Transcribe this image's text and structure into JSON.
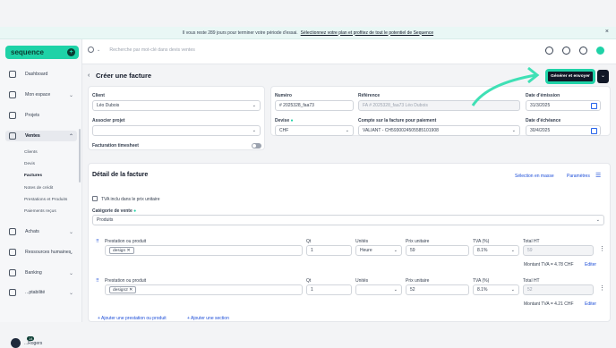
{
  "banner": {
    "text": "Il vous reste 289 jours pour terminer votre période d'essai.",
    "link": "Sélectionnez votre plan et profitez de tout le potentiel de Sequence"
  },
  "logo": {
    "text": "sequence"
  },
  "sidebar": {
    "items": [
      "Dashboard",
      "Mon espace",
      "Projets",
      "Ventes",
      "Achats",
      "Ressources humaines",
      "Banking",
      "...ptabilité"
    ],
    "ventes_sub": [
      "Clients",
      "Devis",
      "Factures",
      "Notes de crédit",
      "Prestations et Produits",
      "Paiements reçus"
    ],
    "user": "...Rogers",
    "badge": "14"
  },
  "topbar": {
    "search_placeholder": "Recherche par mot-clé dans devis ventes"
  },
  "page": {
    "title": "Créer une facture",
    "generate_button": "Générer et envoyer"
  },
  "form": {
    "client_label": "Client",
    "client_value": "Léo Dubois",
    "project_label": "Associer projet",
    "timesheet_label": "Facturation timesheet",
    "number_label": "Numéro",
    "number_value": "# 2025328_faa73",
    "reference_label": "Référence",
    "reference_value": "FA # 2025328_faa73 Léo Dubois",
    "emission_label": "Date d'émission",
    "emission_value": "31/3/2025",
    "currency_label": "Devise",
    "currency_value": "CHF",
    "account_label": "Compte sur la facture pour paiement",
    "account_value": "VALIANT - CH5930024505585101908",
    "due_label": "Date d'échéance",
    "due_value": "30/4/2025"
  },
  "details": {
    "title": "Détail de la facture",
    "bulk_link": "Sélection en masse",
    "params_link": "Paramètres",
    "tva_checkbox": "TVA inclu dans le prix unitaire",
    "category_label": "Catégorie de vente",
    "category_value": "Produits",
    "col_prestation": "Prestation ou produit",
    "col_qt": "Qt",
    "col_units": "Unités",
    "col_price": "Prix unitaire",
    "col_tva": "TVA (%)",
    "col_total": "Total HT",
    "rows": [
      {
        "tag": "design",
        "qt": "1",
        "unit": "Heure",
        "price": "59",
        "tva": "8.1%",
        "total": "59",
        "tva_amount": "Montant TVA = 4.78 CHF",
        "edit": "Editer"
      },
      {
        "tag": "design2",
        "qt": "1",
        "unit": "",
        "price": "52",
        "tva": "8.1%",
        "total": "52",
        "tva_amount": "Montant TVA = 4.21 CHF",
        "edit": "Editer"
      }
    ],
    "add_line": "Ajouter une prestation ou produit",
    "add_section": "Ajouter une section"
  }
}
